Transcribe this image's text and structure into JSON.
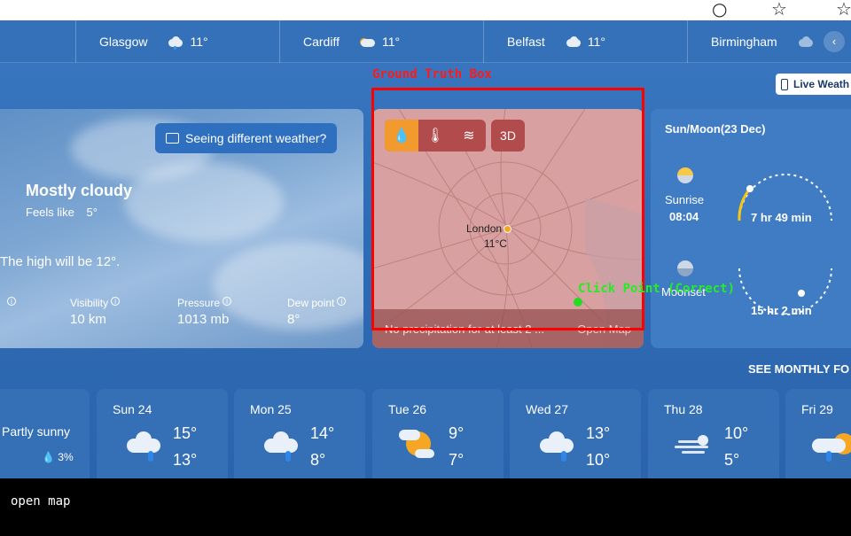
{
  "browser": {
    "icons": [
      "profile-icon",
      "favorites-star-icon",
      "collections-icon"
    ]
  },
  "cities": [
    {
      "name": "Glasgow",
      "temp": "11°",
      "icon": "rain-cloud-icon"
    },
    {
      "name": "Cardiff",
      "temp": "11°",
      "icon": "partly-sunny-icon"
    },
    {
      "name": "Belfast",
      "temp": "11°",
      "icon": "cloud-icon"
    },
    {
      "name": "Birmingham",
      "temp": "",
      "icon": "cloud-icon"
    }
  ],
  "live_weather": "Live Weath",
  "current": {
    "seeing_different": "Seeing different weather?",
    "condition": "Mostly cloudy",
    "feels_like_label": "Feels like",
    "feels_like_value": "5°",
    "summary": "The high will be 12°.",
    "metrics": [
      {
        "label": "Visibility",
        "value": "10 km"
      },
      {
        "label": "Pressure",
        "value": "1013 mb"
      },
      {
        "label": "Dew point",
        "value": "8°"
      }
    ]
  },
  "map": {
    "layers": [
      "precipitation-icon",
      "temperature-icon",
      "wind-icon"
    ],
    "mode_3d": "3D",
    "city": "London",
    "city_temp": "11°C",
    "footer_text": "No precipitation for at least 2 ...",
    "open_map": "Open Map"
  },
  "annotations": {
    "ground_truth": "Ground Truth Box",
    "click_point": "Click Point (Correct)",
    "colors": {
      "box": "#ff0000",
      "click": "#22dd22"
    }
  },
  "sunmoon": {
    "title": "Sun/Moon(23 Dec)",
    "sunrise_label": "Sunrise",
    "sunrise_time": "08:04",
    "day_length": "7 hr 49 min",
    "moonset_label": "Moonset",
    "moon_length": "15 hr 2 min"
  },
  "forecast": {
    "see_monthly": "SEE MONTHLY FO",
    "days": [
      {
        "name": "Partly sunny",
        "hi": "",
        "lo": "",
        "precip": "3%",
        "icon": "partly-sunny-icon"
      },
      {
        "name": "Sun 24",
        "hi": "15°",
        "lo": "13°",
        "icon": "rain-cloud-icon"
      },
      {
        "name": "Mon 25",
        "hi": "14°",
        "lo": "8°",
        "icon": "rain-cloud-icon"
      },
      {
        "name": "Tue 26",
        "hi": "9°",
        "lo": "7°",
        "icon": "partly-sunny-icon"
      },
      {
        "name": "Wed 27",
        "hi": "13°",
        "lo": "10°",
        "icon": "rain-cloud-icon"
      },
      {
        "name": "Thu 28",
        "hi": "10°",
        "lo": "5°",
        "icon": "wind-icon"
      },
      {
        "name": "Fri 29",
        "hi": "",
        "lo": "",
        "icon": "partly-sunny-icon"
      }
    ]
  },
  "caption": "open map"
}
